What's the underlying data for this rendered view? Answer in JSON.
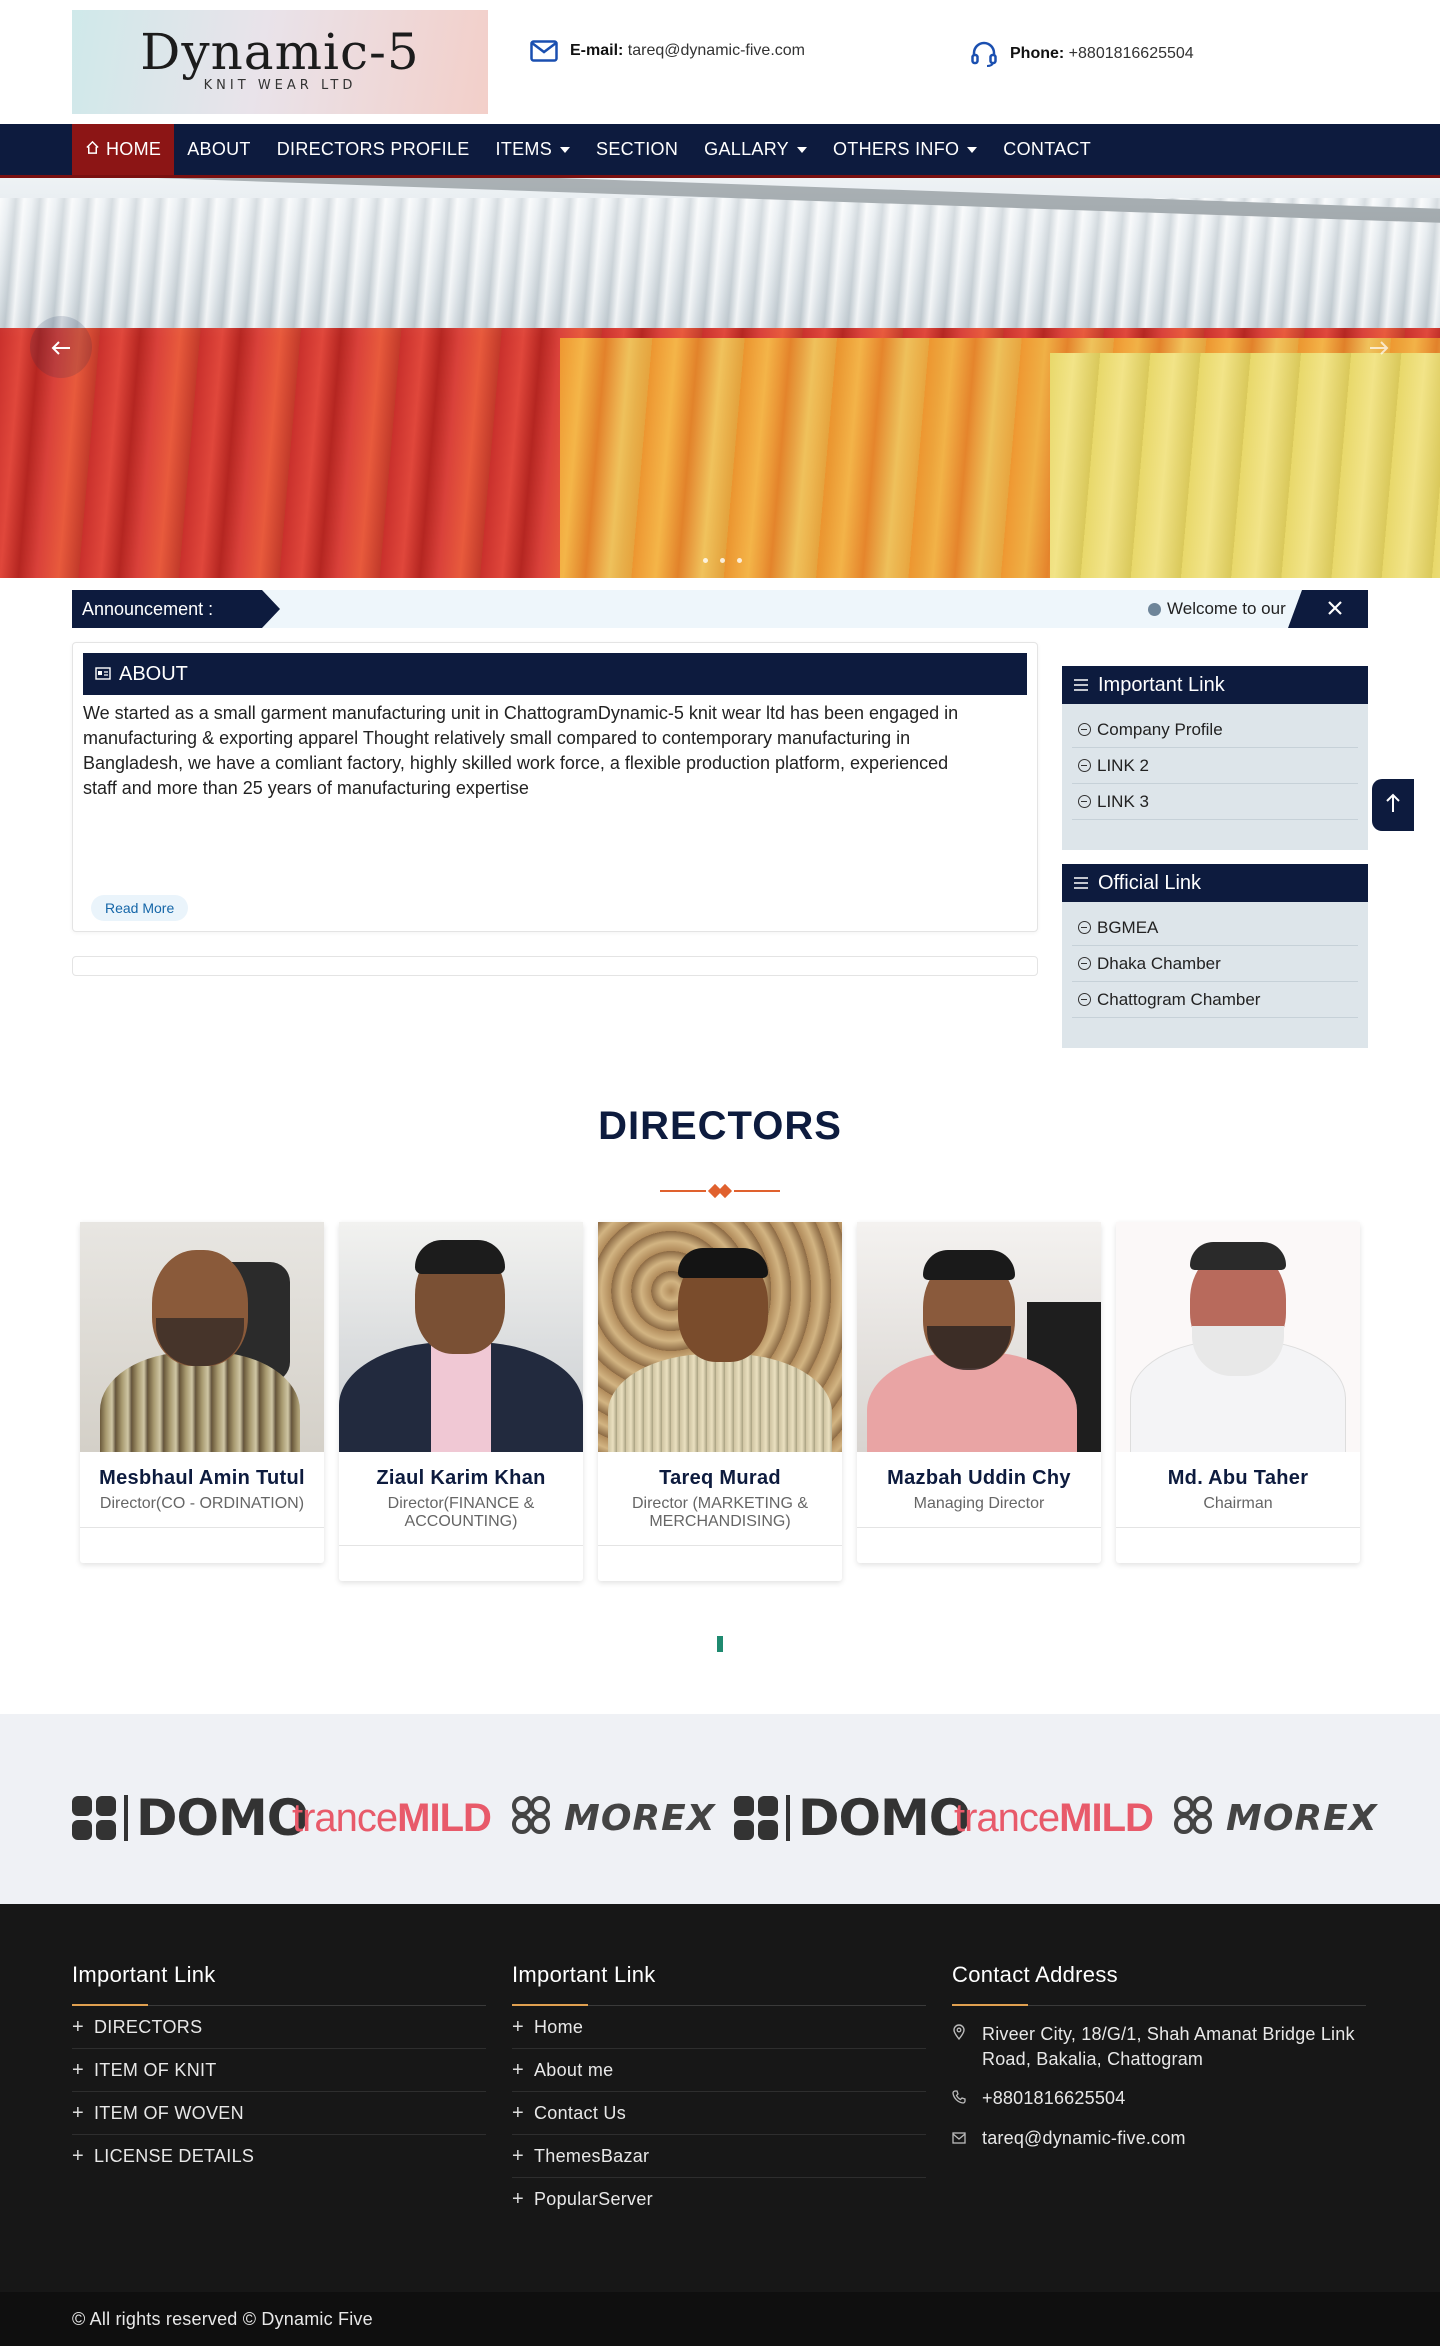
{
  "logo": {
    "name": "Dynamic-5",
    "sub": "KNIT WEAR LTD"
  },
  "header": {
    "email_label": "E-mail:",
    "email": "tareq@dynamic-five.com",
    "phone_label": "Phone:",
    "phone": "+8801816625504"
  },
  "nav": {
    "items": [
      {
        "label": "HOME",
        "active": true
      },
      {
        "label": "ABOUT"
      },
      {
        "label": "DIRECTORS PROFILE"
      },
      {
        "label": "ITEMS",
        "dropdown": true
      },
      {
        "label": "SECTION"
      },
      {
        "label": "GALLARY",
        "dropdown": true
      },
      {
        "label": "OTHERS INFO",
        "dropdown": true
      },
      {
        "label": "CONTACT"
      }
    ]
  },
  "slider": {
    "prev_icon": "arrow-left-icon",
    "next_icon": "arrow-right-icon",
    "dots": 3
  },
  "announcement": {
    "label": "Announcement :",
    "text": "Welcome to our",
    "close_icon": "close-icon"
  },
  "about": {
    "heading": "ABOUT",
    "lines": [
      "We started as a small garment manufacturing unit in ChattogramDynamic-5 knit wear ltd has been engaged in",
      "manufacturing & exporting apparel Thought relatively small compared to contemporary manufacturing in",
      "Bangladesh, we have a comliant factory, highly skilled work force, a flexible production platform, experienced",
      "staff and more than 25 years of manufacturing expertise"
    ],
    "read_more": "Read More"
  },
  "important_links": {
    "heading": "Important Link",
    "items": [
      "Company Profile",
      "LINK 2",
      "LINK 3"
    ]
  },
  "official_links": {
    "heading": "Official Link",
    "items": [
      "BGMEA",
      "Dhaka Chamber",
      "Chattogram Chamber"
    ]
  },
  "directors": {
    "title": "DIRECTORS",
    "people": [
      {
        "name": "Mesbhaul Amin Tutul",
        "role": "Director(CO - ORDINATION)"
      },
      {
        "name": "Ziaul Karim Khan",
        "role": "Director(FINANCE & ACCOUNTING)"
      },
      {
        "name": "Tareq Murad",
        "role": "Director (MARKETING & MERCHANDISING)"
      },
      {
        "name": "Mazbah Uddin Chy",
        "role": "Managing Director"
      },
      {
        "name": "Md. Abu Taher",
        "role": "Chairman"
      }
    ]
  },
  "brands": {
    "items": [
      {
        "type": "domo",
        "text": "DOMO"
      },
      {
        "type": "mild",
        "text_a": "trance",
        "text_b": "MILD"
      },
      {
        "type": "morex",
        "text": "MOREX"
      },
      {
        "type": "domo",
        "text": "DOMO"
      },
      {
        "type": "mild",
        "text_a": "trance",
        "text_b": "MILD"
      },
      {
        "type": "morex",
        "text": "MOREX"
      }
    ]
  },
  "footer": {
    "col1": {
      "heading": "Important Link",
      "items": [
        "DIRECTORS",
        "ITEM OF KNIT",
        "ITEM OF WOVEN",
        "LICENSE DETAILS"
      ]
    },
    "col2": {
      "heading": "Important Link",
      "items": [
        "Home",
        "About me",
        "Contact Us",
        "ThemesBazar",
        "PopularServer"
      ]
    },
    "col3": {
      "heading": "Contact Address",
      "address": "Riveer City, 18/G/1, Shah Amanat Bridge Link Road, Bakalia, Chattogram",
      "phone": "+8801816625504",
      "email": "tareq@dynamic-five.com"
    },
    "copyright": "© All rights reserved © Dynamic Five"
  },
  "colors": {
    "navy": "#0d1b3e",
    "accent_red": "#8c1515",
    "orange": "#e0612e"
  }
}
